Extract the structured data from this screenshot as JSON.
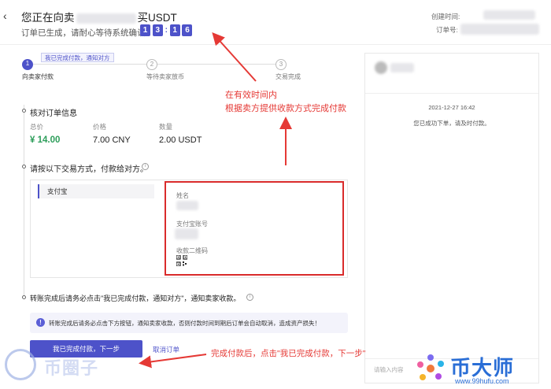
{
  "header": {
    "title_prefix": "您正在向卖",
    "title_suffix": "买USDT",
    "subtitle": "订单已生成，请耐心等待系统确认。",
    "timer": [
      "1",
      "3",
      "1",
      "6"
    ],
    "created_label": "创建时间:",
    "order_label": "订单号:"
  },
  "steps": [
    {
      "num": "1",
      "label": "向卖家付款",
      "tag": "我已完成付款，通知对方"
    },
    {
      "num": "2",
      "label": "等待卖家放币"
    },
    {
      "num": "3",
      "label": "交易完成"
    }
  ],
  "order_info": {
    "title": "核对订单信息",
    "total_label": "总价",
    "total_value": "¥ 14.00",
    "price_label": "价格",
    "price_value": "7.00 CNY",
    "qty_label": "数量",
    "qty_value": "2.00 USDT"
  },
  "payment": {
    "title": "请按以下交易方式，付款给对方。",
    "method": "支付宝",
    "name_label": "姓名",
    "account_label": "支付宝账号",
    "qr_label": "收款二维码"
  },
  "notice": {
    "title": "转账完成后请务必点击\"我已完成付款，通知对方\"，通知卖家收款。",
    "warning": "转账完成后请务必点击下方按钮，通知卖家收款，否则付款时间到期后订单会自动取消，造成资产损失！"
  },
  "buttons": {
    "confirm": "我已完成付款，下一步",
    "cancel": "取消订单"
  },
  "chat": {
    "time": "2021-12-27 16:42",
    "message": "您已成功下单，请及时付款。",
    "input_placeholder": "请输入内容"
  },
  "annotations": {
    "mid_line1": "在有效时间内",
    "mid_line2": "根据卖方提供收款方式完成付款",
    "bottom": "完成付款后，点击\"我已完成付款，下一步\""
  },
  "watermarks": {
    "left": "币圈子",
    "right_title": "币大师",
    "right_url": "www.99hufu.com"
  },
  "colors": {
    "accent": "#4d52c9",
    "price_green": "#2e9e5b",
    "annotation_red": "#e53935"
  }
}
